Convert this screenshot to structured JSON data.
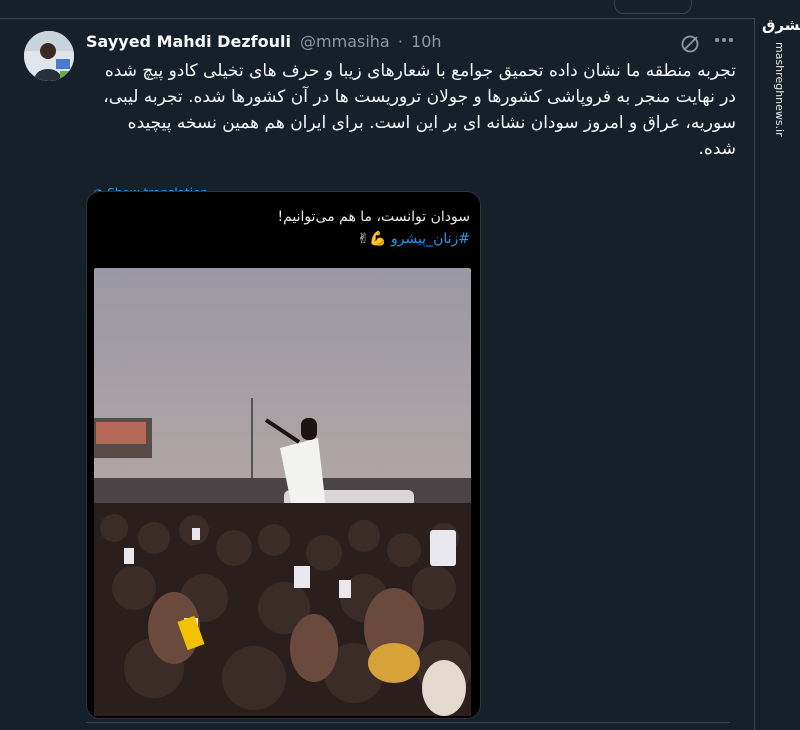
{
  "tweet": {
    "author_name": "Sayyed Mahdi Dezfouli",
    "handle": "@mmasiha",
    "separator": "·",
    "time": "10h",
    "text": "تجربه منطقه ما نشان داده تحمیق جوامع با شعارهای زیبا و حرف های تخیلی کادو پیچ شده در نهایت منجر به فروپاشی کشورها و جولان تروریست ها در آن کشورها شده. تجربه لیبی، سوریه، عراق و امروز سودان نشانه ای بر این است. برای ایران هم همین نسخه پیچیده شده."
  },
  "quoted_media": {
    "translate_label": "Show translation",
    "caption_line1": "سودان توانست، ما هم می‌توانیم!",
    "hashtag": "#زنان_پیشرو",
    "emoji": "💪✌"
  },
  "watermark": {
    "logo": "مشرق",
    "url": "mashreghnews.ir"
  },
  "icons": {
    "more": "more-icon",
    "grok": "grok-icon"
  },
  "colors": {
    "background": "#15202b",
    "text": "#f7f9f9",
    "secondary": "#8b98a5",
    "link": "#1d9bf0"
  }
}
